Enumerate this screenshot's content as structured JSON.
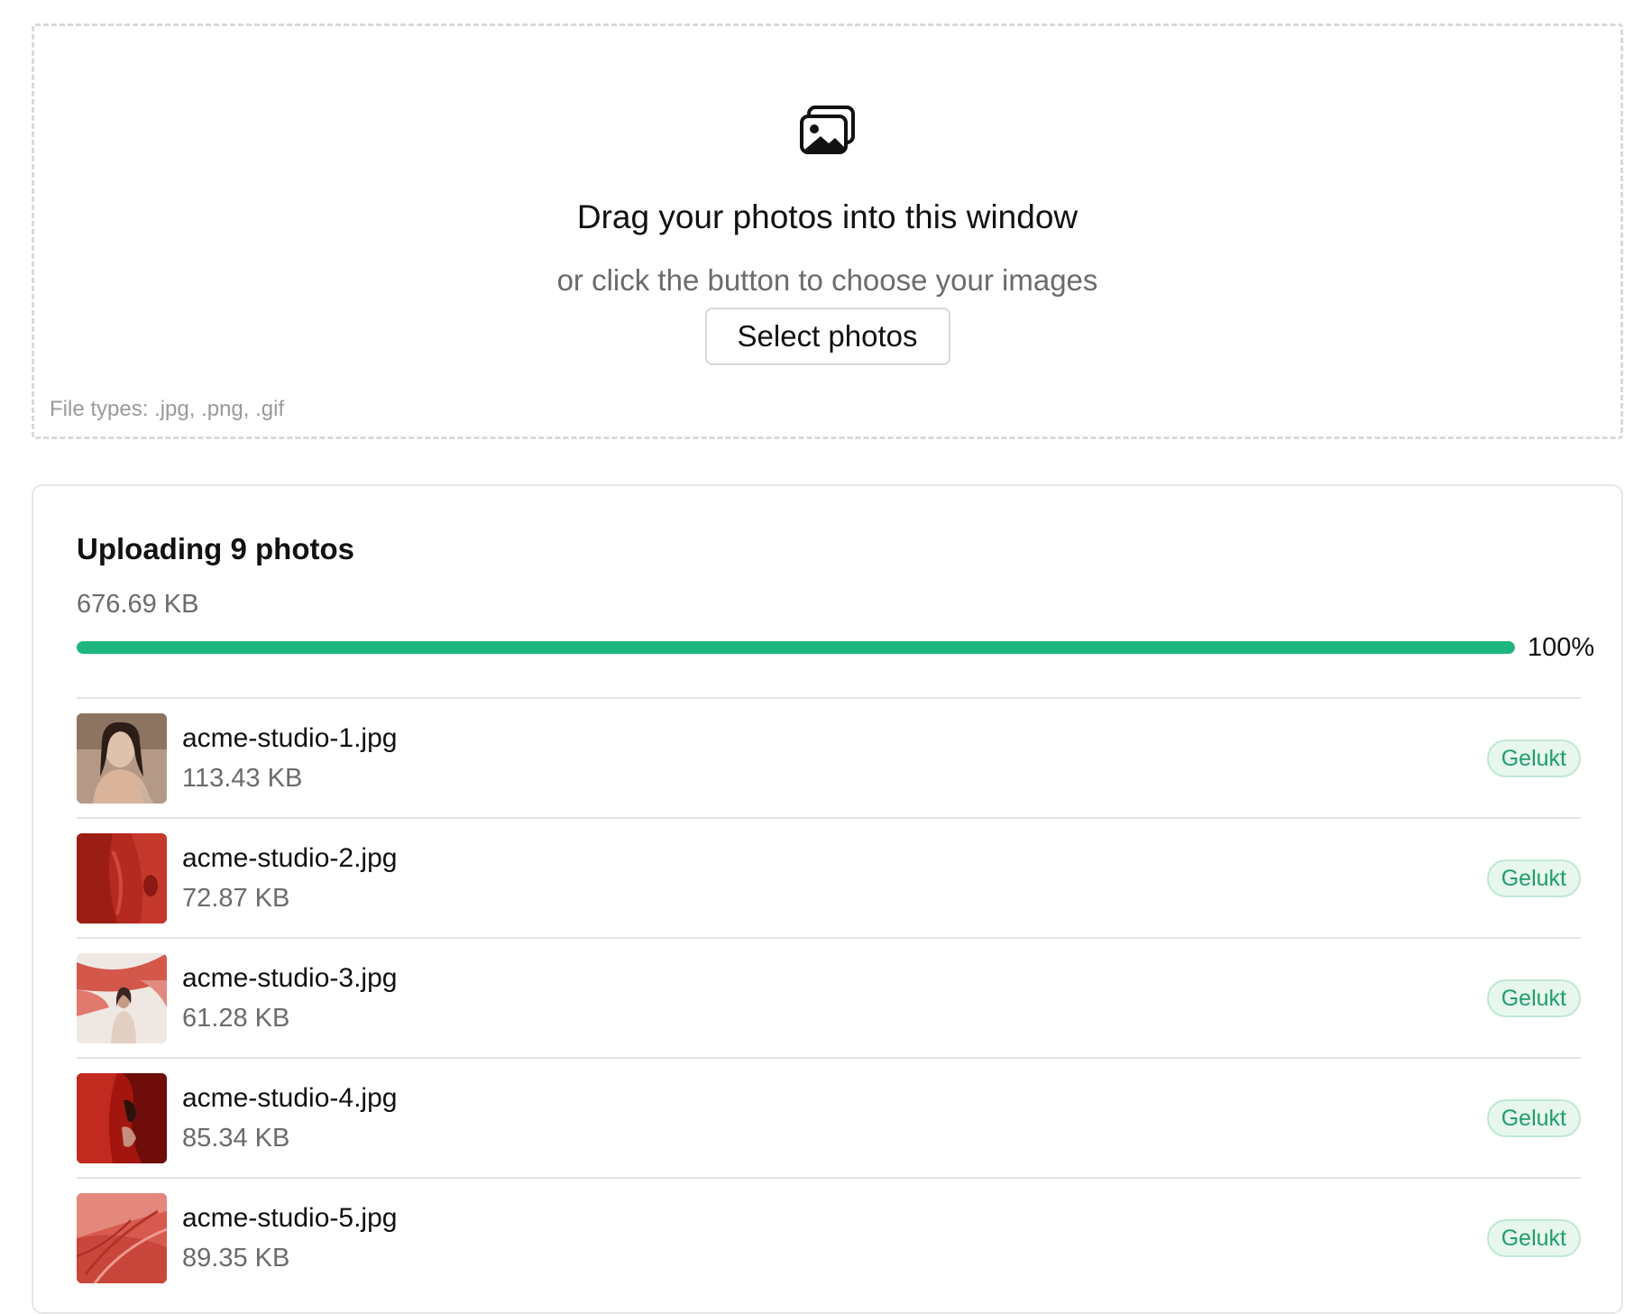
{
  "dropzone": {
    "icon": "images-icon",
    "title": "Drag your photos into this window",
    "subtitle": "or click the button to choose your images",
    "button_label": "Select photos",
    "file_types": "File types: .jpg, .png, .gif"
  },
  "upload": {
    "title": "Uploading 9 photos",
    "total_size": "676.69 KB",
    "progress": 1.0,
    "progress_label": "100%",
    "progress_color": "#1db67e",
    "files": [
      {
        "name": "acme-studio-1.jpg",
        "size": "113.43 KB",
        "status": "Gelukt"
      },
      {
        "name": "acme-studio-2.jpg",
        "size": "72.87 KB",
        "status": "Gelukt"
      },
      {
        "name": "acme-studio-3.jpg",
        "size": "61.28 KB",
        "status": "Gelukt"
      },
      {
        "name": "acme-studio-4.jpg",
        "size": "85.34 KB",
        "status": "Gelukt"
      },
      {
        "name": "acme-studio-5.jpg",
        "size": "89.35 KB",
        "status": "Gelukt"
      }
    ]
  },
  "colors": {
    "success_text": "#1f9e68",
    "success_bg": "#e7f7ee",
    "accent": "#1db67e"
  }
}
